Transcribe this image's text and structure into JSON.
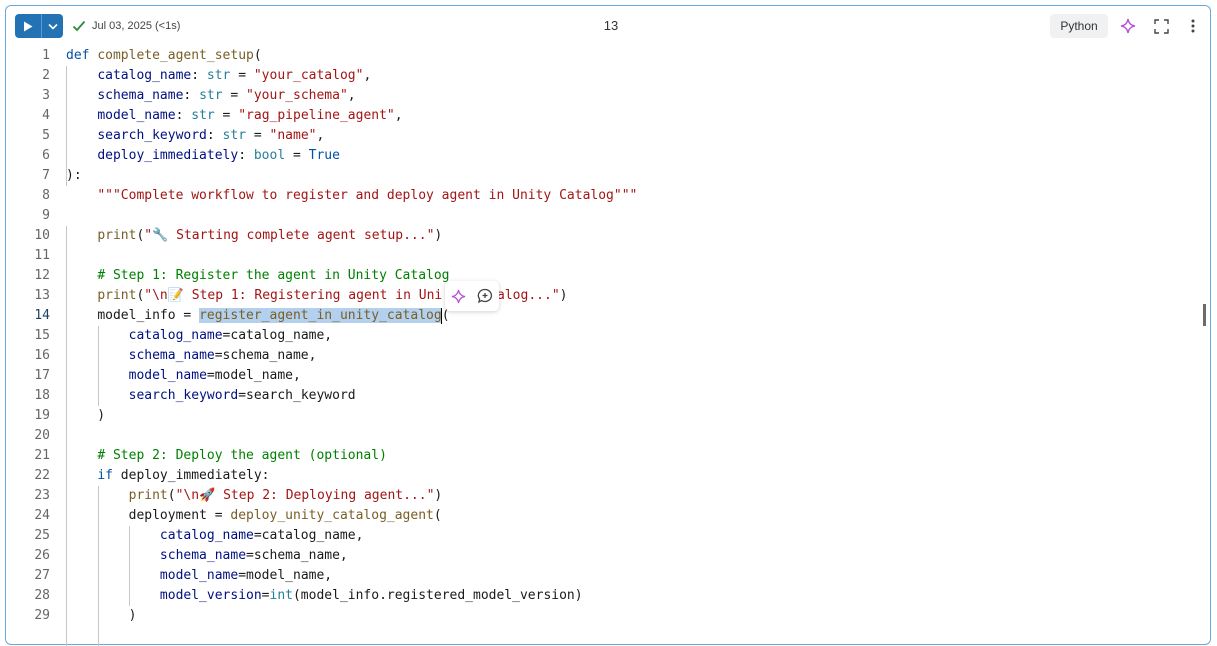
{
  "toolbar": {
    "run_icon": "play-icon",
    "dropdown_icon": "chevron-down-icon",
    "status_icon": "check-icon",
    "status_text": "Jul 03, 2025 (<1s)",
    "cell_number": "13",
    "language": "Python",
    "assistant_icon": "sparkle-icon",
    "expand_icon": "expand-icon",
    "more_icon": "more-vertical-icon"
  },
  "popover": {
    "assistant_icon": "sparkle-icon",
    "comment_icon": "comment-add-icon"
  },
  "editor": {
    "active_line": 14,
    "lines": [
      {
        "n": "1",
        "tokens": [
          [
            "def ",
            "kw"
          ],
          [
            "complete_agent_setup",
            "fn"
          ],
          [
            "(",
            ""
          ]
        ]
      },
      {
        "n": "2",
        "tokens": [
          [
            "    ",
            ""
          ],
          [
            "catalog_name",
            "param"
          ],
          [
            ": ",
            ""
          ],
          [
            "str",
            "type"
          ],
          [
            " = ",
            ""
          ],
          [
            "\"your_catalog\"",
            "str"
          ],
          [
            ",",
            ""
          ]
        ]
      },
      {
        "n": "3",
        "tokens": [
          [
            "    ",
            ""
          ],
          [
            "schema_name",
            "param"
          ],
          [
            ": ",
            ""
          ],
          [
            "str",
            "type"
          ],
          [
            " = ",
            ""
          ],
          [
            "\"your_schema\"",
            "str"
          ],
          [
            ",",
            ""
          ]
        ]
      },
      {
        "n": "4",
        "tokens": [
          [
            "    ",
            ""
          ],
          [
            "model_name",
            "param"
          ],
          [
            ": ",
            ""
          ],
          [
            "str",
            "type"
          ],
          [
            " = ",
            ""
          ],
          [
            "\"rag_pipeline_agent\"",
            "str"
          ],
          [
            ",",
            ""
          ]
        ]
      },
      {
        "n": "5",
        "tokens": [
          [
            "    ",
            ""
          ],
          [
            "search_keyword",
            "param"
          ],
          [
            ": ",
            ""
          ],
          [
            "str",
            "type"
          ],
          [
            " = ",
            ""
          ],
          [
            "\"name\"",
            "str"
          ],
          [
            ",",
            ""
          ]
        ]
      },
      {
        "n": "6",
        "tokens": [
          [
            "    ",
            ""
          ],
          [
            "deploy_immediately",
            "param"
          ],
          [
            ": ",
            ""
          ],
          [
            "bool",
            "type"
          ],
          [
            " = ",
            ""
          ],
          [
            "True",
            "kw"
          ]
        ]
      },
      {
        "n": "7",
        "tokens": [
          [
            "):",
            ""
          ]
        ]
      },
      {
        "n": "8",
        "tokens": [
          [
            "    ",
            ""
          ],
          [
            "\"\"\"Complete workflow to register and deploy agent in Unity Catalog\"\"\"",
            "str"
          ]
        ]
      },
      {
        "n": "9",
        "tokens": []
      },
      {
        "n": "10",
        "tokens": [
          [
            "    ",
            ""
          ],
          [
            "print",
            "fn"
          ],
          [
            "(",
            ""
          ],
          [
            "\"🔧 Starting complete agent setup...\"",
            "str"
          ],
          [
            ")",
            ""
          ]
        ]
      },
      {
        "n": "11",
        "tokens": []
      },
      {
        "n": "12",
        "tokens": [
          [
            "    ",
            ""
          ],
          [
            "# Step 1: Register the agent in Unity Catalog",
            "cmt"
          ]
        ]
      },
      {
        "n": "13",
        "tokens": [
          [
            "    ",
            ""
          ],
          [
            "print",
            "fn"
          ],
          [
            "(",
            ""
          ],
          [
            "\"\\n📝 Step 1: Registering agent in Uni",
            "str"
          ],
          [
            "       ",
            ""
          ],
          [
            "alog...\"",
            "str"
          ],
          [
            ")",
            ""
          ]
        ]
      },
      {
        "n": "14",
        "tokens": [
          [
            "    ",
            ""
          ],
          [
            "model_info = ",
            ""
          ],
          [
            "register_agent_in_unity_catalog",
            "fn sel"
          ],
          [
            "CARET",
            "caret"
          ],
          [
            "(",
            ""
          ]
        ]
      },
      {
        "n": "15",
        "tokens": [
          [
            "        ",
            ""
          ],
          [
            "catalog_name",
            "param"
          ],
          [
            "=catalog_name,",
            ""
          ]
        ]
      },
      {
        "n": "16",
        "tokens": [
          [
            "        ",
            ""
          ],
          [
            "schema_name",
            "param"
          ],
          [
            "=schema_name,",
            ""
          ]
        ]
      },
      {
        "n": "17",
        "tokens": [
          [
            "        ",
            ""
          ],
          [
            "model_name",
            "param"
          ],
          [
            "=model_name,",
            ""
          ]
        ]
      },
      {
        "n": "18",
        "tokens": [
          [
            "        ",
            ""
          ],
          [
            "search_keyword",
            "param"
          ],
          [
            "=search_keyword",
            ""
          ]
        ]
      },
      {
        "n": "19",
        "tokens": [
          [
            "    )",
            ""
          ]
        ]
      },
      {
        "n": "20",
        "tokens": []
      },
      {
        "n": "21",
        "tokens": [
          [
            "    ",
            ""
          ],
          [
            "# Step 2: Deploy the agent (optional)",
            "cmt"
          ]
        ]
      },
      {
        "n": "22",
        "tokens": [
          [
            "    ",
            ""
          ],
          [
            "if",
            "kw"
          ],
          [
            " deploy_immediately:",
            ""
          ]
        ]
      },
      {
        "n": "23",
        "tokens": [
          [
            "        ",
            ""
          ],
          [
            "print",
            "fn"
          ],
          [
            "(",
            ""
          ],
          [
            "\"\\n🚀 Step 2: Deploying agent...\"",
            "str"
          ],
          [
            ")",
            ""
          ]
        ]
      },
      {
        "n": "24",
        "tokens": [
          [
            "        ",
            ""
          ],
          [
            "deployment = ",
            ""
          ],
          [
            "deploy_unity_catalog_agent",
            "fn"
          ],
          [
            "(",
            ""
          ]
        ]
      },
      {
        "n": "25",
        "tokens": [
          [
            "            ",
            ""
          ],
          [
            "catalog_name",
            "param"
          ],
          [
            "=catalog_name,",
            ""
          ]
        ]
      },
      {
        "n": "26",
        "tokens": [
          [
            "            ",
            ""
          ],
          [
            "schema_name",
            "param"
          ],
          [
            "=schema_name,",
            ""
          ]
        ]
      },
      {
        "n": "27",
        "tokens": [
          [
            "            ",
            ""
          ],
          [
            "model_name",
            "param"
          ],
          [
            "=model_name,",
            ""
          ]
        ]
      },
      {
        "n": "28",
        "tokens": [
          [
            "            ",
            ""
          ],
          [
            "model_version",
            "param"
          ],
          [
            "=",
            ""
          ],
          [
            "int",
            "type"
          ],
          [
            "(model_info.registered_model_version)",
            ""
          ]
        ]
      },
      {
        "n": "29",
        "tokens": [
          [
            "        )",
            ""
          ]
        ]
      }
    ]
  }
}
